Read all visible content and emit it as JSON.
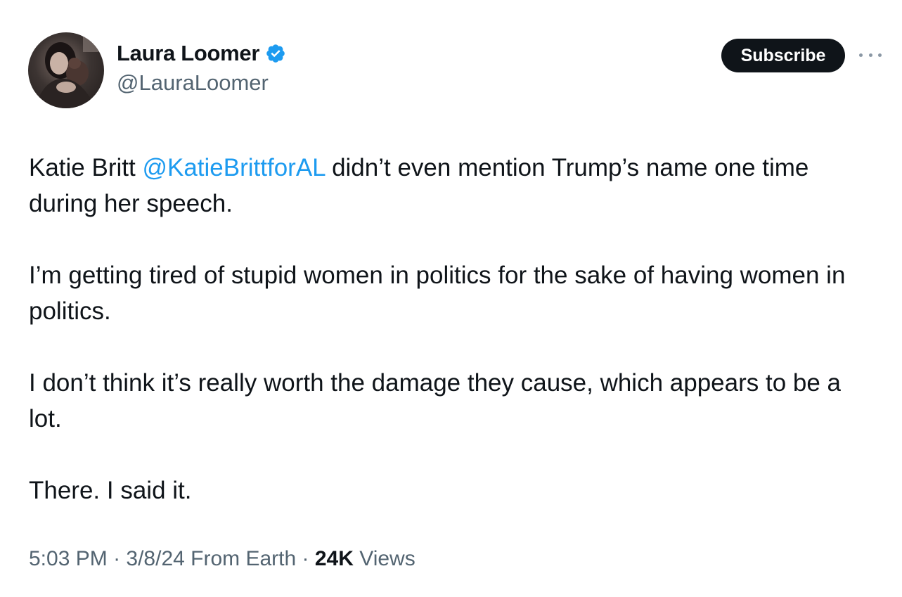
{
  "author": {
    "display_name": "Laura Loomer",
    "handle": "@LauraLoomer",
    "avatar_icon": "profile-photo",
    "verified_icon": "verified-badge-icon",
    "verified_color": "#1d9bf0"
  },
  "actions": {
    "subscribe_label": "Subscribe",
    "more_icon": "more-options-icon"
  },
  "tweet": {
    "line1_prefix": "Katie Britt ",
    "mention": "@KatieBrittforAL",
    "line1_suffix": " didn’t even mention Trump’s name one time during her speech.",
    "paragraph2": "I’m getting tired of stupid women in politics for the sake of having women in politics.",
    "paragraph3": "I don’t think it’s really worth the damage they cause, which appears to be a lot.",
    "paragraph4": "There. I said it."
  },
  "meta": {
    "time": "5:03 PM",
    "separator": " · ",
    "date_source": "3/8/24 From Earth",
    "views_count": "24K",
    "views_label": " Views"
  },
  "colors": {
    "text": "#0f1419",
    "secondary": "#536471",
    "link": "#1d9bf0",
    "button_bg": "#0f1419"
  }
}
